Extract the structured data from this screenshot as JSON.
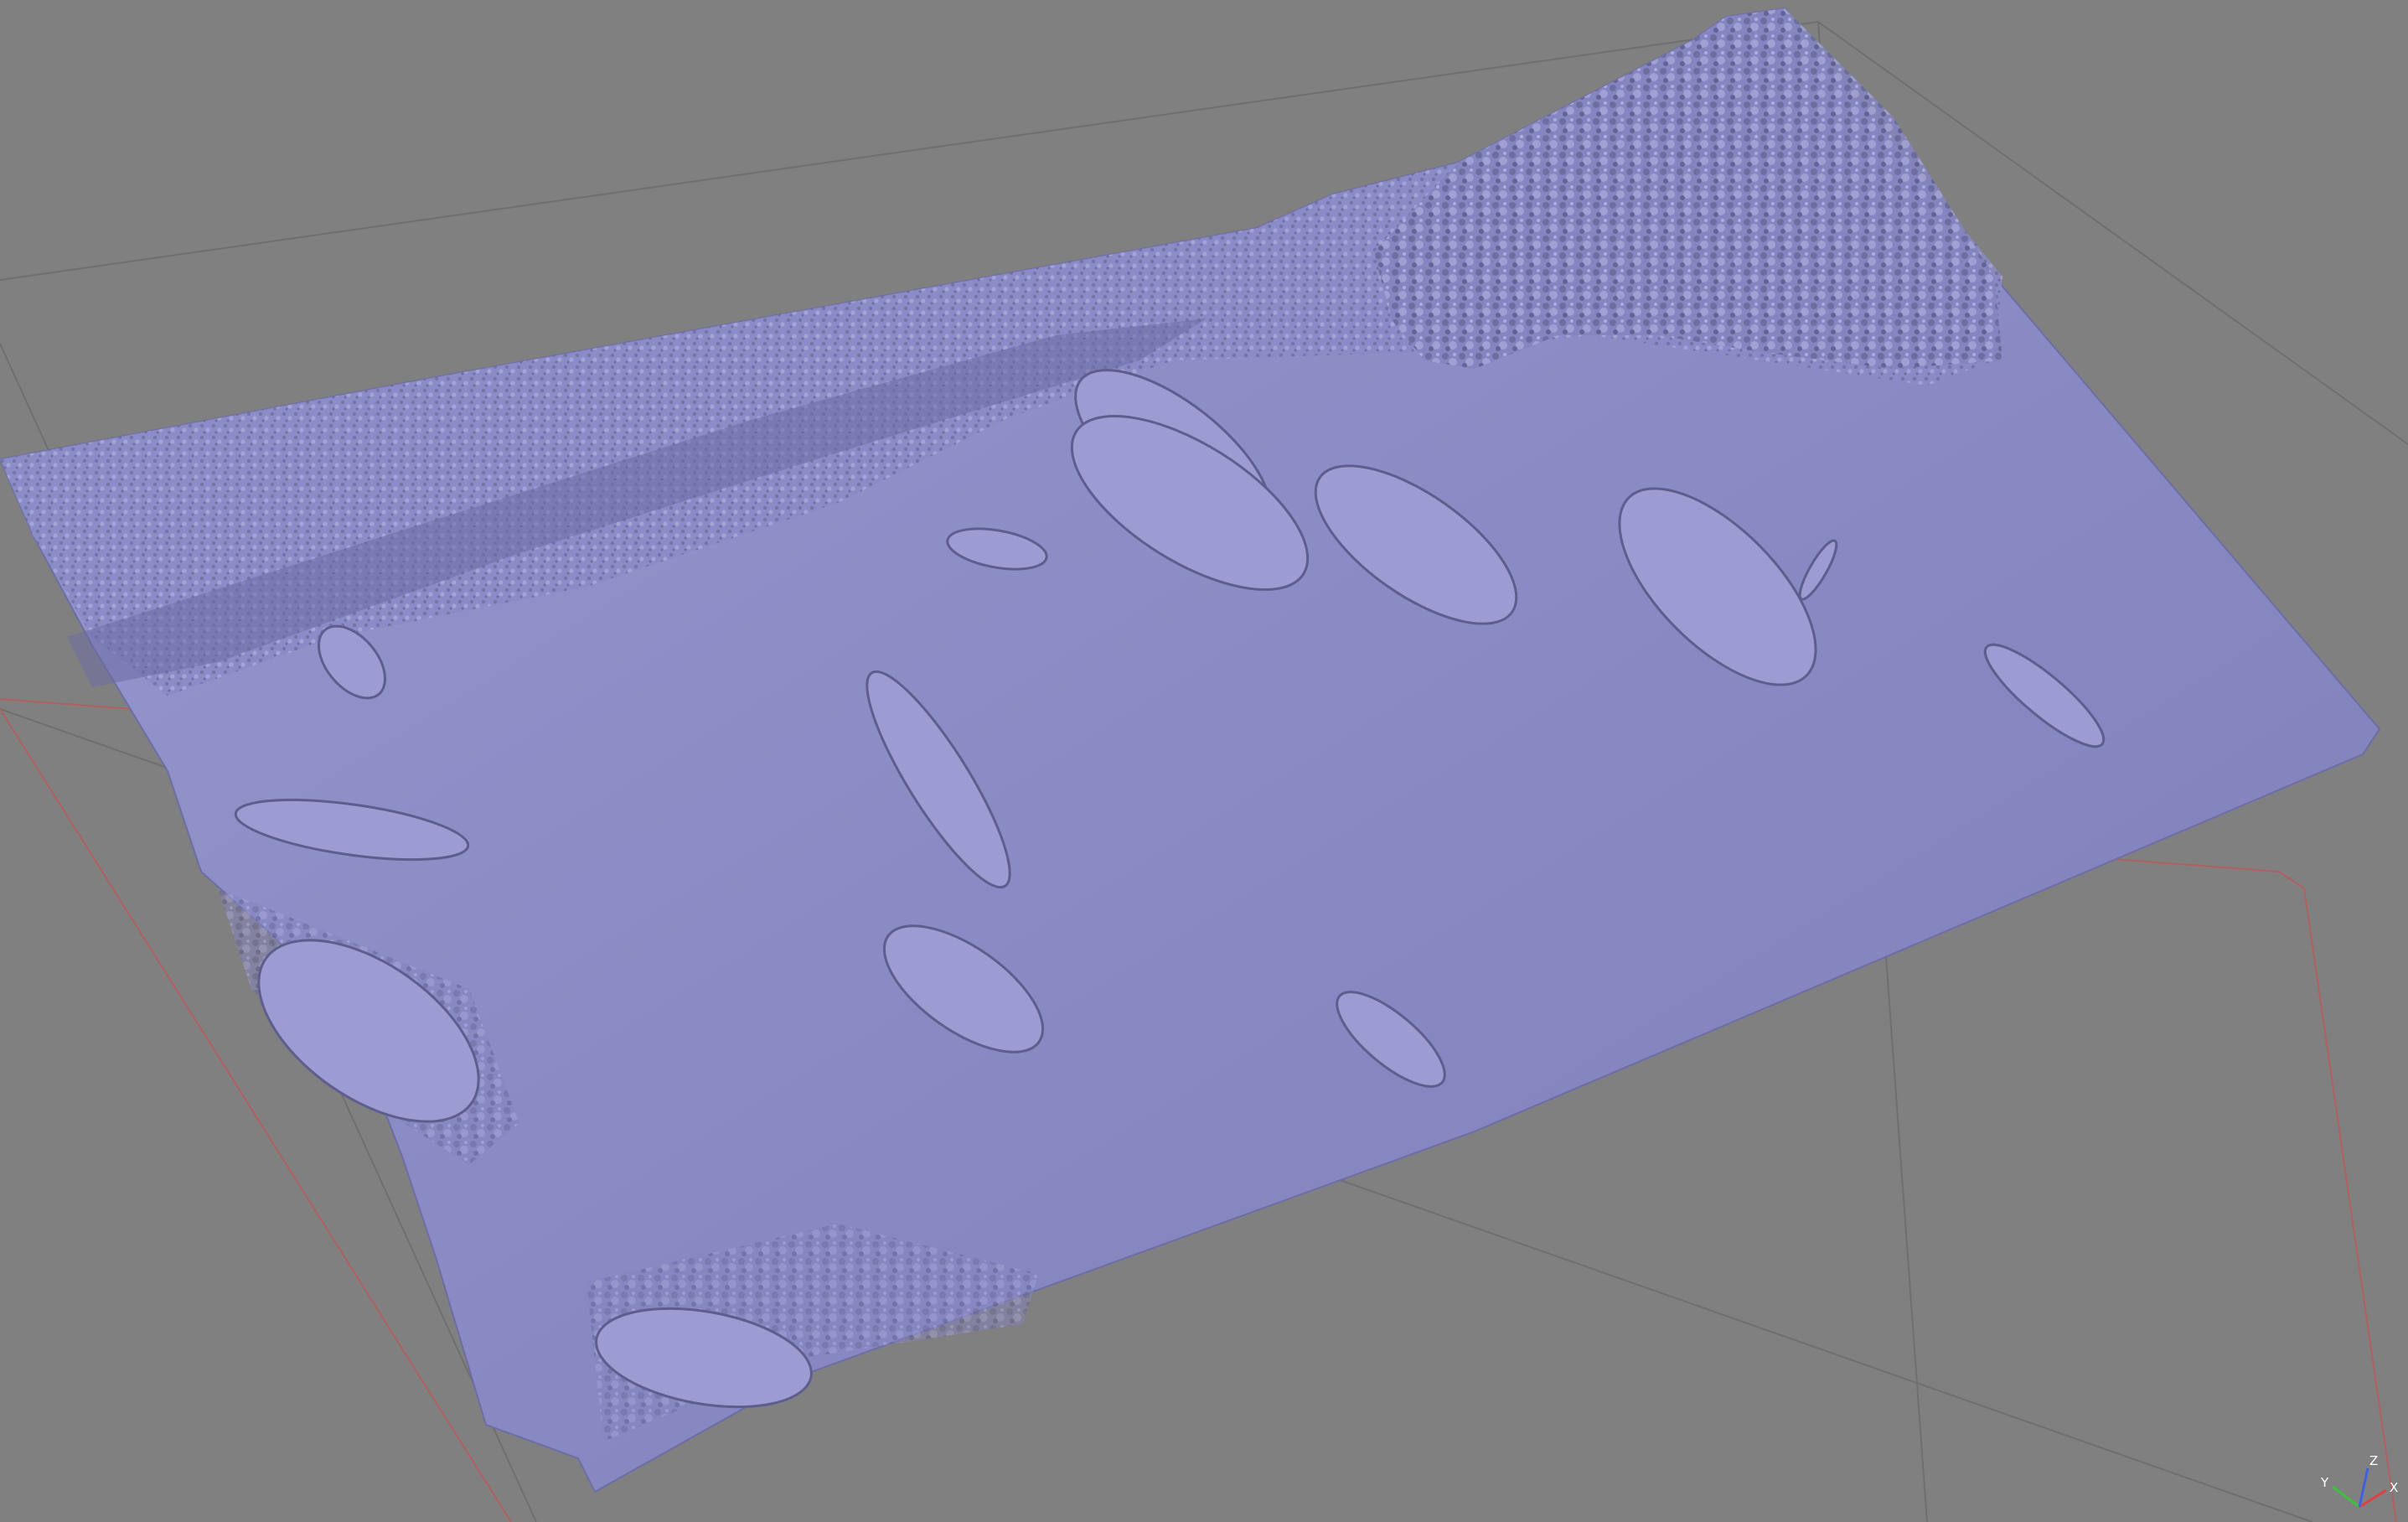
{
  "viewport": {
    "background_color": "#808080",
    "mesh_color": "#8c8cc6",
    "grid_color": "#6f6f6f",
    "bounding_box_color": "#b06060"
  },
  "axis_gizmo": {
    "x_label": "X",
    "y_label": "Y",
    "z_label": "Z",
    "x_color": "#e04040",
    "y_color": "#40c040",
    "z_color": "#4060e0"
  }
}
